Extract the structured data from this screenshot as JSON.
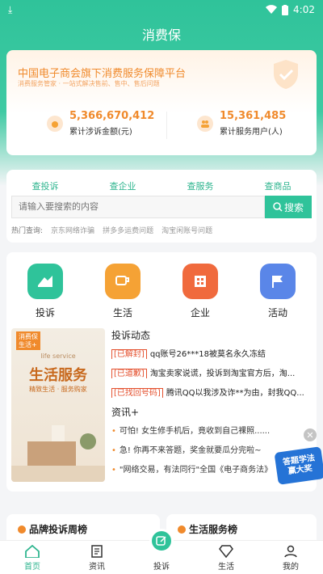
{
  "status": {
    "time": "4:02"
  },
  "app": {
    "title": "消费保"
  },
  "hero": {
    "title": "中国电子商会旗下消费服务保障平台",
    "subtitle": "消费服务管家 · 一站式解决售前、售中、售后问题",
    "stats": [
      {
        "value": "5,366,670,412",
        "label": "累计涉诉金额(元)"
      },
      {
        "value": "15,361,485",
        "label": "累计服务用户(人)"
      }
    ]
  },
  "search": {
    "tabs": [
      "查投诉",
      "查企业",
      "查服务",
      "查商品"
    ],
    "placeholder": "请输入要搜索的内容",
    "button_label": "搜索",
    "hot_label": "热门查询:",
    "hot_items": [
      "京东网络诈骗",
      "拼多多运费问题",
      "淘宝闲账号问题"
    ]
  },
  "categories": [
    {
      "label": "投诉",
      "color": "#2fc39a",
      "icon": "complaint-icon"
    },
    {
      "label": "生活",
      "color": "#f5a235",
      "icon": "cup-icon"
    },
    {
      "label": "企业",
      "color": "#f06a3d",
      "icon": "building-icon"
    },
    {
      "label": "活动",
      "color": "#5a86e8",
      "icon": "flag-icon"
    }
  ],
  "poster": {
    "badge": "消费保\n生活+",
    "en": "life service",
    "big": "生活服务",
    "small": "精致生活 · 服务购家"
  },
  "complaints": {
    "heading": "投诉动态",
    "items": [
      {
        "tag": "[已解封]",
        "text": "qq账号26***18被莫名永久冻结"
      },
      {
        "tag": "[已道歉]",
        "text": "淘宝卖家说谎，投诉到淘宝官方后，淘..."
      },
      {
        "tag": "[已找回号码]",
        "text": "腾讯QQ以我涉及诈**为由，封我QQ..."
      }
    ]
  },
  "info": {
    "heading": "资讯+",
    "items": [
      "可怕! 女生修手机后，竟收到自己裸照......",
      "急! 你再不来答题，奖金就要瓜分完啦~",
      "\"网络交易，有法同行\"全国《电子商务法》"
    ]
  },
  "quiz_badge": "答题学法\n赢大奖",
  "rankings": [
    "品牌投诉周榜",
    "生活服务榜"
  ],
  "nav": [
    {
      "label": "首页",
      "icon": "home-icon",
      "active": true
    },
    {
      "label": "资讯",
      "icon": "news-icon",
      "active": false
    },
    {
      "label": "投诉",
      "icon": "edit-icon",
      "active": false
    },
    {
      "label": "生活",
      "icon": "diamond-icon",
      "active": false
    },
    {
      "label": "我的",
      "icon": "user-icon",
      "active": false
    }
  ]
}
